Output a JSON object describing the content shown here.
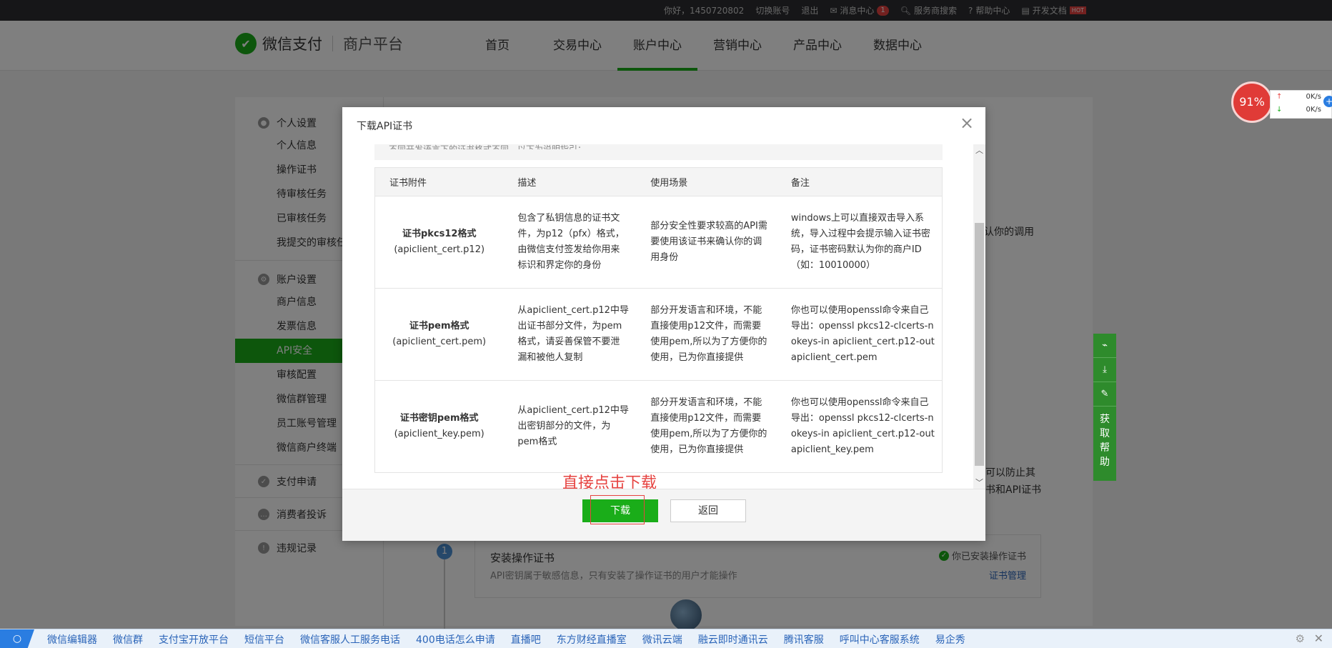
{
  "topbar": {
    "greeting": "你好，1450720802",
    "switch_account": "切换账号",
    "logout": "退出",
    "messages": "消息中心",
    "messages_count": "1",
    "search": "服务商搜索",
    "help": "帮助中心",
    "dev_docs": "开发文档",
    "hot": "HOT"
  },
  "header": {
    "logo_brand": "微信支付",
    "logo_sub": "商户平台",
    "nav": [
      "首页",
      "交易中心",
      "账户中心",
      "营销中心",
      "产品中心",
      "数据中心"
    ]
  },
  "sidebar": {
    "group_personal": "个人设置",
    "personal_items": [
      "个人信息",
      "操作证书",
      "待审核任务",
      "已审核任务",
      "我提交的审核任"
    ],
    "group_account": "账户设置",
    "account_items": [
      "商户信息",
      "发票信息",
      "API安全",
      "审核配置",
      "微信群管理",
      "员工账号管理",
      "微信商户终端"
    ],
    "pay_apply": "支付申请",
    "complaints": "消费者投诉",
    "violations": "违规记录"
  },
  "main_bg": {
    "frag_right_1": "认你的调用",
    "frag_right_2": "可以防止其",
    "frag_right_3": "书和API证书",
    "step_num": "1",
    "step_title": "安装操作证书",
    "step_desc": "API密钥属于敏感信息，只有安装了操作证书的用户才能操作",
    "step_status": "你已安装操作证书",
    "step_link": "证书管理"
  },
  "modal": {
    "title": "下载API证书",
    "intro_fragment": "不同开发语言下的证书格式不同，以下为说明指引：",
    "columns": [
      "证书附件",
      "描述",
      "使用场景",
      "备注"
    ],
    "rows": [
      {
        "name": "证书pkcs12格式",
        "file": "(apiclient_cert.p12)",
        "desc": "包含了私钥信息的证书文件，为p12（pfx）格式，由微信支付签发给你用来标识和界定你的身份",
        "usage": "部分安全性要求较高的API需要使用该证书来确认你的调用身份",
        "note": "windows上可以直接双击导入系统，导入过程中会提示输入证书密码，证书密码默认为你的商户ID（如：10010000）"
      },
      {
        "name": "证书pem格式",
        "file": "(apiclient_cert.pem)",
        "desc": "从apiclient_cert.p12中导出证书部分文件，为pem格式，请妥善保管不要泄漏和被他人复制",
        "usage": "部分开发语言和环境，不能直接使用p12文件，而需要使用pem,所以为了方便你的使用，已为你直接提供",
        "note": "你也可以使用openssl命令来自己导出：openssl pkcs12-clcerts-nokeys-in apiclient_cert.p12-out apiclient_cert.pem"
      },
      {
        "name": "证书密钥pem格式",
        "file": "(apiclient_key.pem)",
        "desc": "从apiclient_cert.p12中导出密钥部分的文件，为pem格式",
        "usage": "部分开发语言和环境，不能直接使用p12文件，而需要使用pem,所以为了方便你的使用，已为你直接提供",
        "note": "你也可以使用openssl命令来自己导出：openssl pkcs12-clcerts-nokeys-in apiclient_cert.p12-out apiclient_key.pem"
      }
    ],
    "annotation": "直接点击下载",
    "download": "下载",
    "back": "返回"
  },
  "network_widget": {
    "percent": "91%",
    "upload": "0K/s",
    "download": "0K/s"
  },
  "float_tools": {
    "help_label": "获取帮助"
  },
  "taskbar": {
    "links": [
      "微信编辑器",
      "微信群",
      "支付宝开放平台",
      "短信平台",
      "微信客服人工服务电话",
      "400电话怎么申请",
      "直播吧",
      "东方财经直播室",
      "微讯云端",
      "融云即时通讯云",
      "腾讯客服",
      "呼叫中心客服系统",
      "易企秀"
    ]
  },
  "colors": {
    "brand_green": "#1aad19",
    "annotation_red": "#e64340",
    "topbar_bg": "#2c2d31"
  }
}
